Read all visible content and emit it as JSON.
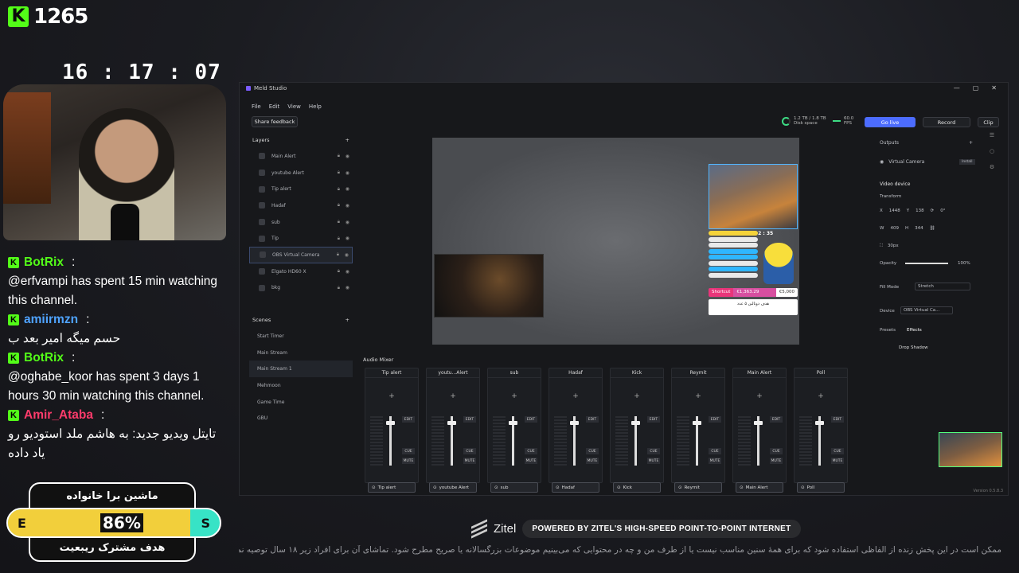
{
  "overlay": {
    "kick_count": "1265",
    "clock": "16 : 17 : 07",
    "chat": [
      {
        "user": "BotRix",
        "color": "#53fc18",
        "text": "@erfvampi has spent 15 min watching this channel."
      },
      {
        "user": "amiirmzn",
        "color": "#4fa3ff",
        "text": "حسم میگه امیر بعد ب"
      },
      {
        "user": "BotRix",
        "color": "#53fc18",
        "text": "@oghabe_koor has spent 3 days 1 hours 30 min watching this channel."
      },
      {
        "user": "Amir_Ataba",
        "color": "#ff3b6b",
        "text": "تایتل ویدیو جدید: به هاشم ملد استودیو رو یاد داده"
      }
    ],
    "goal": {
      "top": "ماشین برا خانواده",
      "bottom": "هدف مشترک ریبعیت",
      "percent_label": "86%",
      "fraction": 0.86,
      "left_letter": "E",
      "right_letter": "S"
    }
  },
  "meld": {
    "title": "Meld Studio",
    "menu": [
      "File",
      "Edit",
      "View",
      "Help"
    ],
    "share_feedback": "Share feedback",
    "disk": {
      "value": "1.2 TB / 1.8 TB",
      "label": "Disk space"
    },
    "fps": {
      "value": "60.0",
      "label": "FPS"
    },
    "go_live": "Go live",
    "record": "Record",
    "clip": "Clip",
    "layers_title": "Layers",
    "layers": [
      {
        "name": "Main Alert",
        "sel": false
      },
      {
        "name": "youtube Alert",
        "sel": false
      },
      {
        "name": "Tip alert",
        "sel": false
      },
      {
        "name": "Hadaf",
        "sel": false
      },
      {
        "name": "sub",
        "sel": false
      },
      {
        "name": "Tip",
        "sel": false
      },
      {
        "name": "OBS Virtual Camera",
        "sel": true
      },
      {
        "name": "Elgato HD60 X",
        "sel": false
      },
      {
        "name": "bkg",
        "sel": false
      }
    ],
    "scenes_title": "Scenes",
    "scenes": [
      {
        "name": "Start Timer",
        "sel": false
      },
      {
        "name": "Main Stream",
        "sel": false
      },
      {
        "name": "Main Stream 1",
        "sel": true
      },
      {
        "name": "Mehmoon",
        "sel": false
      },
      {
        "name": "Game Time",
        "sel": false
      },
      {
        "name": "GBU",
        "sel": false
      }
    ],
    "canvas": {
      "cam_time": "25 : 02 : 35",
      "shortcut": {
        "label": "Shortcut",
        "amount": "€1,363.29",
        "goal": "€5,000"
      },
      "goal_text": "هدف دوتالین ۵ عدد"
    },
    "outputs": {
      "title": "Outputs",
      "virtual_camera": "Virtual Camera",
      "install": "Install",
      "video_device": "Video device",
      "transform": "Transform",
      "x": "1448",
      "y": "138",
      "rot": "0°",
      "w": "409",
      "h": "344",
      "px": "30px",
      "opacity_label": "Opacity",
      "opacity": "100%",
      "opacity_fraction": 1.0,
      "fill_mode_label": "Fill Mode",
      "fill_mode": "Stretch",
      "device_label": "Device",
      "device": "OBS Virtual Ca...",
      "presets": "Presets",
      "effects": "Effects",
      "drop_shadow": "Drop Shadow"
    },
    "mixer": {
      "title": "Audio Mixer",
      "channels": [
        {
          "head": "Tip alert",
          "foot": "Tip alert"
        },
        {
          "head": "youtu...Alert",
          "foot": "youtube Alert"
        },
        {
          "head": "sub",
          "foot": "sub"
        },
        {
          "head": "Hadaf",
          "foot": "Hadaf"
        },
        {
          "head": "Kick",
          "foot": "Kick"
        },
        {
          "head": "Reymit",
          "foot": "Reymit"
        },
        {
          "head": "Main Alert",
          "foot": "Main Alert"
        },
        {
          "head": "Poll",
          "foot": "Poll"
        }
      ],
      "edit": "EDIT",
      "cue": "CUE",
      "mute": "MUTE"
    },
    "version": "Version 0.5.8.3"
  },
  "sponsor": {
    "name": "Zitel",
    "tagline": "POWERED BY ZITEL'S HIGH-SPEED POINT-TO-POINT INTERNET"
  },
  "disclaimer": "ممکن است در این پخش زنده از الفاظی استفاده شود که برای همهٔ سنین مناسب نیست یا از طرف من و چه در محتوایی که می‌بینیم موضوعات بزرگسالانه یا صریح مطرح شود. تماشای آن برای افراد زیر ۱۸ سال توصیه نمی‌شود."
}
